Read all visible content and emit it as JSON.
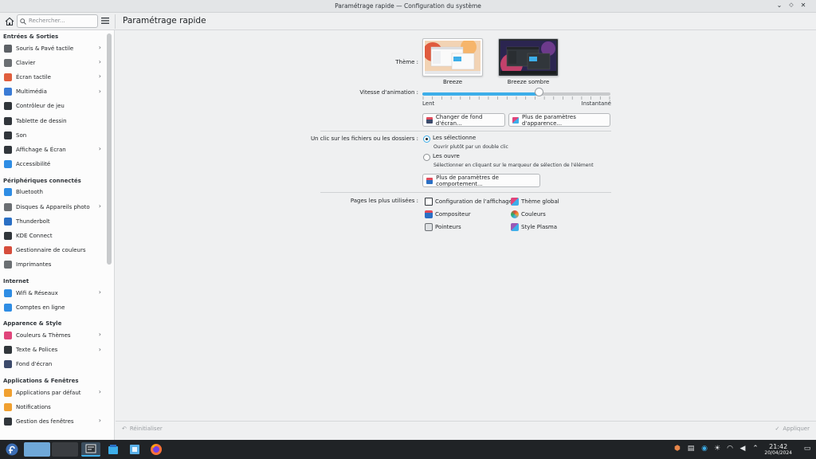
{
  "window": {
    "title": "Paramétrage rapide — Configuration du système",
    "controls": [
      "chevron-down",
      "diamond",
      "close"
    ]
  },
  "header": {
    "search_placeholder": "Rechercher...",
    "page_title": "Paramétrage rapide"
  },
  "sidebar": {
    "categories": [
      {
        "label": "Entrées & Sorties",
        "items": [
          {
            "label": "Souris & Pavé tactile",
            "icon": "mouse-icon",
            "chevron": true,
            "color": "#5d6166"
          },
          {
            "label": "Clavier",
            "icon": "keyboard-icon",
            "chevron": true,
            "color": "#6b6f73"
          },
          {
            "label": "Écran tactile",
            "icon": "touchscreen-icon",
            "chevron": true,
            "color": "#e05e3d"
          },
          {
            "label": "Multimédia",
            "icon": "multimedia-icon",
            "chevron": true,
            "color": "#3a7bd5"
          },
          {
            "label": "Contrôleur de jeu",
            "icon": "gamepad-icon",
            "chevron": false,
            "color": "#31363b"
          },
          {
            "label": "Tablette de dessin",
            "icon": "tablet-icon",
            "chevron": false,
            "color": "#31363b"
          },
          {
            "label": "Son",
            "icon": "speaker-icon",
            "chevron": false,
            "color": "#31363b"
          },
          {
            "label": "Affichage & Écran",
            "icon": "display-icon",
            "chevron": true,
            "color": "#31363b"
          },
          {
            "label": "Accessibilité",
            "icon": "accessibility-icon",
            "chevron": false,
            "color": "#2f8de4"
          }
        ]
      },
      {
        "label": "Périphériques connectés",
        "items": [
          {
            "label": "Bluetooth",
            "icon": "bluetooth-icon",
            "chevron": false,
            "color": "#2f8de4"
          },
          {
            "label": "Disques & Appareils photo",
            "icon": "disk-icon",
            "chevron": true,
            "color": "#6b6f73"
          },
          {
            "label": "Thunderbolt",
            "icon": "thunderbolt-icon",
            "chevron": false,
            "color": "#2a6fc4"
          },
          {
            "label": "KDE Connect",
            "icon": "phone-icon",
            "chevron": false,
            "color": "#31363b"
          },
          {
            "label": "Gestionnaire de couleurs",
            "icon": "color-manager-icon",
            "chevron": false,
            "color": "#d64d3c"
          },
          {
            "label": "Imprimantes",
            "icon": "printer-icon",
            "chevron": false,
            "color": "#6b6f73"
          }
        ]
      },
      {
        "label": "Internet",
        "items": [
          {
            "label": "Wifi & Réseaux",
            "icon": "wifi-icon",
            "chevron": true,
            "color": "#2f8de4"
          },
          {
            "label": "Comptes en ligne",
            "icon": "online-accounts-icon",
            "chevron": false,
            "color": "#2f8de4"
          }
        ]
      },
      {
        "label": "Apparence & Style",
        "items": [
          {
            "label": "Couleurs & Thèmes",
            "icon": "colors-themes-icon",
            "chevron": true,
            "color": "#e0457b"
          },
          {
            "label": "Texte & Polices",
            "icon": "font-icon",
            "chevron": true,
            "color": "#31363b"
          },
          {
            "label": "Fond d'écran",
            "icon": "wallpaper-icon",
            "chevron": false,
            "color": "#3c4a6b"
          }
        ]
      },
      {
        "label": "Applications & Fenêtres",
        "items": [
          {
            "label": "Applications par défaut",
            "icon": "default-apps-icon",
            "chevron": true,
            "color": "#f0a030"
          },
          {
            "label": "Notifications",
            "icon": "bell-icon",
            "chevron": false,
            "color": "#f0a030"
          },
          {
            "label": "Gestion des fenêtres",
            "icon": "windows-icon",
            "chevron": true,
            "color": "#31363b"
          }
        ]
      }
    ]
  },
  "main": {
    "theme_label": "Thème :",
    "themes": [
      {
        "label": "Breeze",
        "variant": "light"
      },
      {
        "label": "Breeze sombre",
        "variant": "dark"
      }
    ],
    "animation_label": "Vitesse d'animation :",
    "animation_min": "Lent",
    "animation_max": "Instantané",
    "animation_value": 0.62,
    "wallpaper_button": "Changer de fond d'écran...",
    "appearance_button": "Plus de paramètres d'apparence...",
    "click_label": "Un clic sur les fichiers ou les dossiers :",
    "click_options": [
      {
        "label": "Les sélectionne",
        "hint": "Ouvrir plutôt par un double clic",
        "selected": true
      },
      {
        "label": "Les ouvre",
        "hint": "Sélectionner en cliquant sur le marqueur de sélection de l'élément",
        "selected": false
      }
    ],
    "behavior_button": "Plus de paramètres de comportement...",
    "pages_label": "Pages les plus utilisées :",
    "pages": [
      {
        "label": "Configuration de l'affichage",
        "icon": "display-config-icon"
      },
      {
        "label": "Thème global",
        "icon": "global-theme-icon"
      },
      {
        "label": "Compositeur",
        "icon": "compositor-icon"
      },
      {
        "label": "Couleurs",
        "icon": "colors-icon"
      },
      {
        "label": "Pointeurs",
        "icon": "cursor-icon"
      },
      {
        "label": "Style Plasma",
        "icon": "plasma-style-icon"
      }
    ]
  },
  "footer": {
    "reset_label": "Réinitialiser",
    "apply_label": "Appliquer"
  },
  "taskbar": {
    "time": "21:42",
    "date": "20/04/2024"
  },
  "colors": {
    "accent": "#3daee9",
    "taskbar": "#202326"
  }
}
